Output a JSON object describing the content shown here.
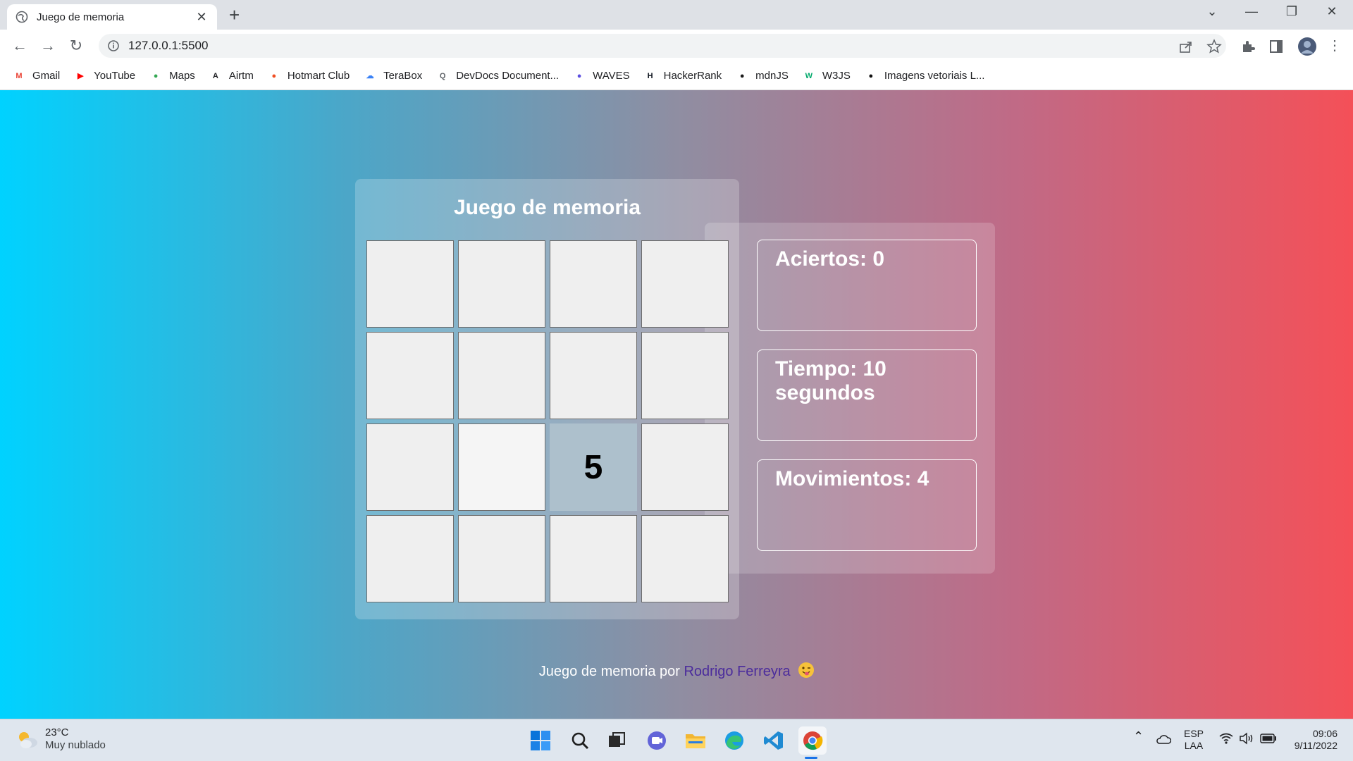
{
  "browser": {
    "tab_title": "Juego de memoria",
    "tab_close": "✕",
    "new_tab": "+",
    "url": "127.0.0.1:5500",
    "window_controls": {
      "dropdown": "⌄",
      "minimize": "—",
      "restore": "❐",
      "close": "✕"
    },
    "bookmarks": [
      {
        "label": "Gmail",
        "icon": "gmail-icon",
        "glyph": "M",
        "color": "#ea4335"
      },
      {
        "label": "YouTube",
        "icon": "youtube-icon",
        "glyph": "▶",
        "color": "#ff0000"
      },
      {
        "label": "Maps",
        "icon": "maps-icon",
        "glyph": "●",
        "color": "#34a853"
      },
      {
        "label": "Airtm",
        "icon": "airtm-icon",
        "glyph": "A",
        "color": "#202124"
      },
      {
        "label": "Hotmart Club",
        "icon": "hotmart-icon",
        "glyph": "●",
        "color": "#f04e23"
      },
      {
        "label": "TeraBox",
        "icon": "terabox-icon",
        "glyph": "☁",
        "color": "#3b82f6"
      },
      {
        "label": "DevDocs Document...",
        "icon": "devdocs-icon",
        "glyph": "Q",
        "color": "#5f6368"
      },
      {
        "label": "WAVES",
        "icon": "waves-icon",
        "glyph": "●",
        "color": "#5b4ee0"
      },
      {
        "label": "HackerRank",
        "icon": "hackerrank-icon",
        "glyph": "H",
        "color": "#0e141e"
      },
      {
        "label": "mdnJS",
        "icon": "mdn-icon",
        "glyph": "●",
        "color": "#1b1b1b"
      },
      {
        "label": "W3JS",
        "icon": "w3-icon",
        "glyph": "W",
        "color": "#04aa6d"
      },
      {
        "label": "Imagens vetoriais L...",
        "icon": "vector-icon",
        "glyph": "●",
        "color": "#111111"
      }
    ]
  },
  "game": {
    "title": "Juego de memoria",
    "cards": [
      "",
      "",
      "",
      "",
      "",
      "",
      "",
      "",
      "",
      "",
      "5",
      "",
      "",
      "",
      "",
      ""
    ],
    "card_states": [
      "hidden",
      "hidden",
      "hidden",
      "hidden",
      "hidden",
      "hidden",
      "hidden",
      "hidden",
      "hidden",
      "dim",
      "flipped",
      "hidden",
      "hidden",
      "hidden",
      "hidden",
      "hidden"
    ],
    "stats": {
      "hits": "Aciertos: 0",
      "time": "Tiempo: 10 segundos",
      "moves": "Movimientos: 4"
    },
    "footer_prefix": "Juego de memoria por ",
    "footer_author": "Rodrigo Ferreyra"
  },
  "taskbar": {
    "temperature": "23°C",
    "weather_desc": "Muy nublado",
    "lang_top": "ESP",
    "lang_bottom": "LAA",
    "time": "09:06",
    "date": "9/11/2022"
  },
  "colors": {
    "gradient_start": "#00d2ff",
    "gradient_end": "#f45058",
    "author_link": "#4b2c9c",
    "flipped_card": "#adc0cc"
  }
}
